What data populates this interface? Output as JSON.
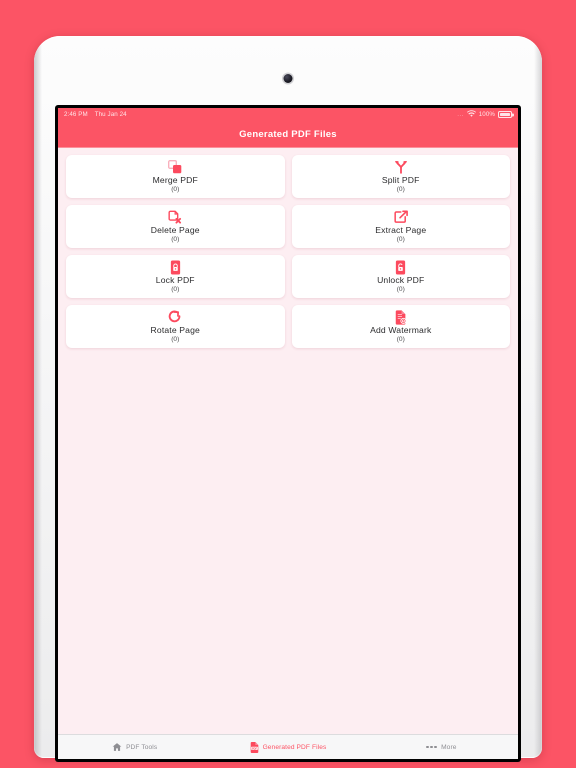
{
  "theme": {
    "accent": "#fc5465",
    "screen_bg": "#fdeef2",
    "card_bg": "#ffffff",
    "tabbar_bg": "#f7f7f8",
    "inactive_tab": "#8e8e93"
  },
  "status_bar": {
    "time": "2:46 PM",
    "date": "Thu Jan 24",
    "dots": "...",
    "wifi_icon": "wifi-icon",
    "battery_percent": "100%",
    "battery_icon": "battery-full-icon"
  },
  "nav_bar": {
    "title": "Generated PDF Files"
  },
  "tools": [
    {
      "label": "Merge PDF",
      "count": "(0)",
      "icon": "merge-squares-icon"
    },
    {
      "label": "Split PDF",
      "count": "(0)",
      "icon": "split-fork-icon"
    },
    {
      "label": "Delete Page",
      "count": "(0)",
      "icon": "document-delete-icon"
    },
    {
      "label": "Extract Page",
      "count": "(0)",
      "icon": "document-extract-icon"
    },
    {
      "label": "Lock PDF",
      "count": "(0)",
      "icon": "lock-icon"
    },
    {
      "label": "Unlock PDF",
      "count": "(0)",
      "icon": "unlock-icon"
    },
    {
      "label": "Rotate Page",
      "count": "(0)",
      "icon": "rotate-arrow-icon"
    },
    {
      "label": "Add Watermark",
      "count": "(0)",
      "icon": "document-watermark-icon"
    }
  ],
  "tab_bar": {
    "tabs": [
      {
        "label": "PDF Tools",
        "icon": "home-icon",
        "active": false
      },
      {
        "label": "Generated PDF Files",
        "icon": "pdf-file-icon",
        "active": true
      },
      {
        "label": "More",
        "icon": "ellipsis-icon",
        "active": false
      }
    ]
  }
}
